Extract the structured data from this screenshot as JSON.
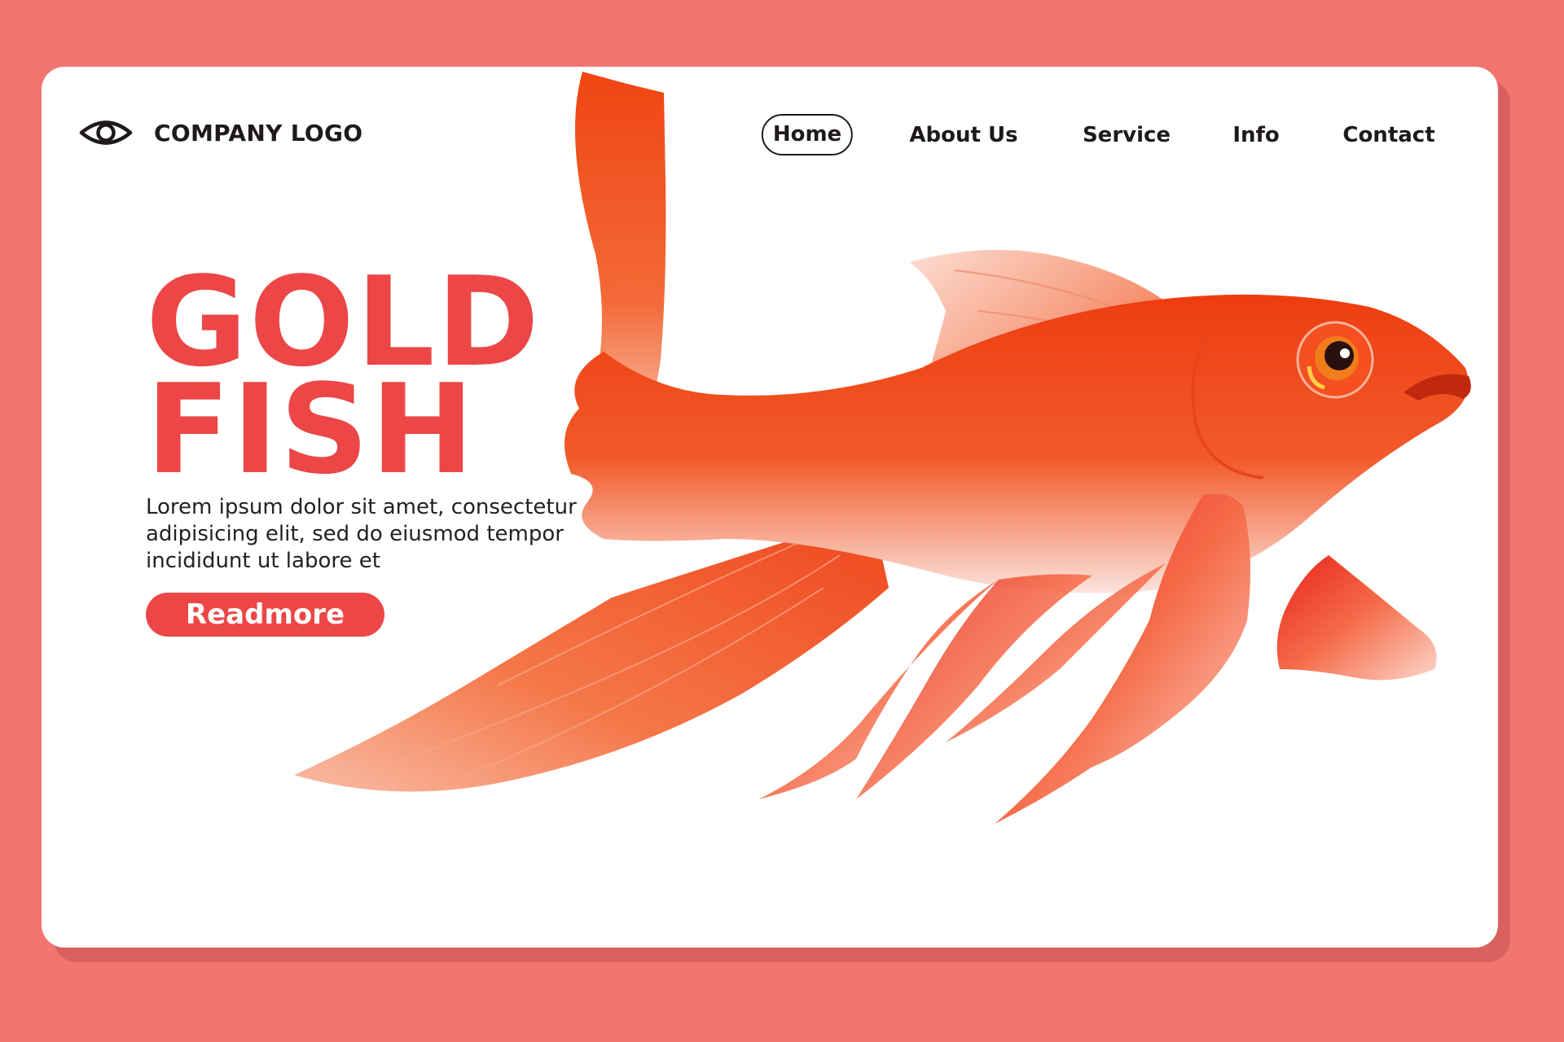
{
  "brand": {
    "logo_icon": "eye-icon",
    "logo_text": "COMPANY LOGO"
  },
  "nav": {
    "items": [
      {
        "label": "Home",
        "active": true
      },
      {
        "label": "About Us",
        "active": false
      },
      {
        "label": "Service",
        "active": false
      },
      {
        "label": "Info",
        "active": false
      },
      {
        "label": "Contact",
        "active": false
      }
    ]
  },
  "hero": {
    "title_line1": "GOLD",
    "title_line2": "FISH",
    "description": "Lorem ipsum dolor sit amet, consectetur adipisicing elit, sed do eiusmod tempor incididunt ut labore et",
    "cta_label": "Readmore"
  },
  "colors": {
    "background": "#f27571",
    "card": "#ffffff",
    "accent": "#ec4646",
    "text": "#1f1a1a",
    "fish_primary": "#ee3e12"
  }
}
